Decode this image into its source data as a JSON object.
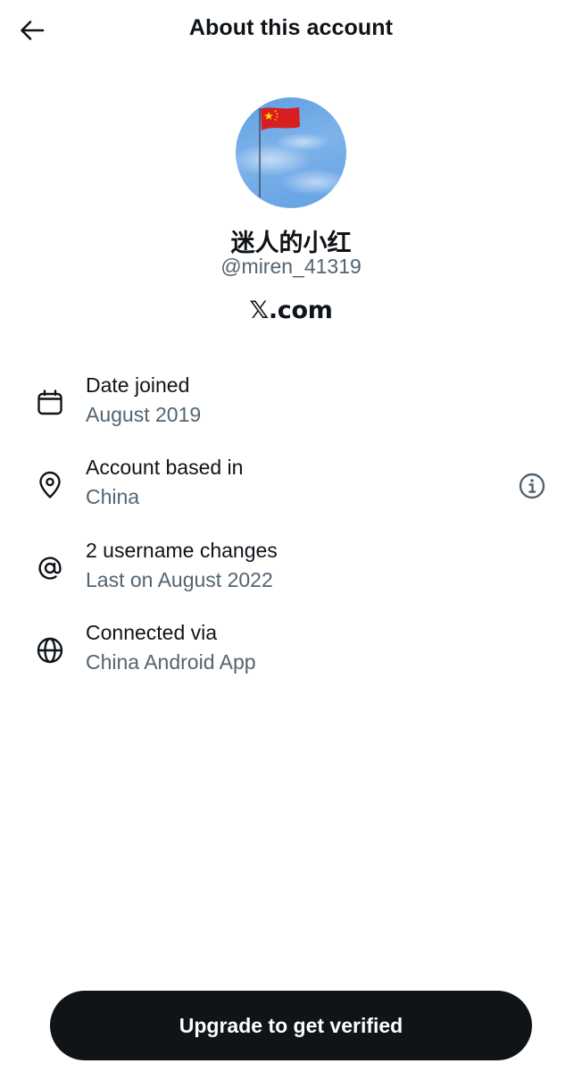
{
  "header": {
    "title": "About this account",
    "back_icon": "arrow-left-icon"
  },
  "profile": {
    "display_name": "迷人的小红",
    "username": "@miren_41319",
    "domain": "𝕏.com",
    "avatar": "flag-photo"
  },
  "info": [
    {
      "icon": "calendar-icon",
      "label": "Date joined",
      "value": "August 2019"
    },
    {
      "icon": "location-pin-icon",
      "label": "Account based in",
      "value": "China",
      "action_icon": "info-icon"
    },
    {
      "icon": "at-sign-icon",
      "label": "2 username changes",
      "value": "Last on August 2022"
    },
    {
      "icon": "globe-icon",
      "label": "Connected via",
      "value": "China Android App"
    }
  ],
  "cta": {
    "label": "Upgrade to get verified"
  },
  "colors": {
    "text_primary": "#0f1419",
    "text_secondary": "#536471",
    "button_bg": "#0f1419"
  }
}
